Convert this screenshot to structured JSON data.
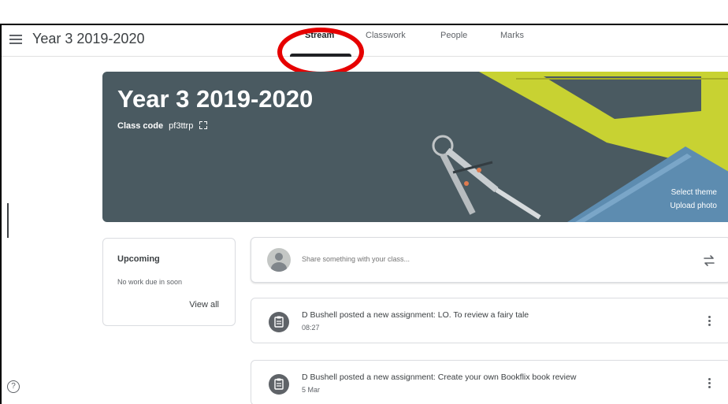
{
  "header": {
    "class_title": "Year 3 2019-2020",
    "tabs": [
      {
        "label": "Stream",
        "active": true
      },
      {
        "label": "Classwork",
        "active": false
      },
      {
        "label": "People",
        "active": false
      },
      {
        "label": "Marks",
        "active": false
      }
    ]
  },
  "banner": {
    "title": "Year 3 2019-2020",
    "class_code_label": "Class code",
    "class_code": "pf3ttrp",
    "select_theme": "Select theme",
    "upload_photo": "Upload photo",
    "color": "#4a5a61"
  },
  "upcoming": {
    "title": "Upcoming",
    "subtitle": "No work due in soon",
    "link": "View all"
  },
  "share": {
    "placeholder": "Share something with your class..."
  },
  "posts": [
    {
      "text": "D Bushell posted a new assignment: LO. To review a fairy tale",
      "time": "08:27"
    },
    {
      "text": "D Bushell posted a new assignment: Create your own Bookflix book review",
      "time": "5 Mar"
    }
  ],
  "colors": {
    "highlight_ring": "#e60000",
    "tab_active": "#202124",
    "text_secondary": "#5f6368"
  }
}
